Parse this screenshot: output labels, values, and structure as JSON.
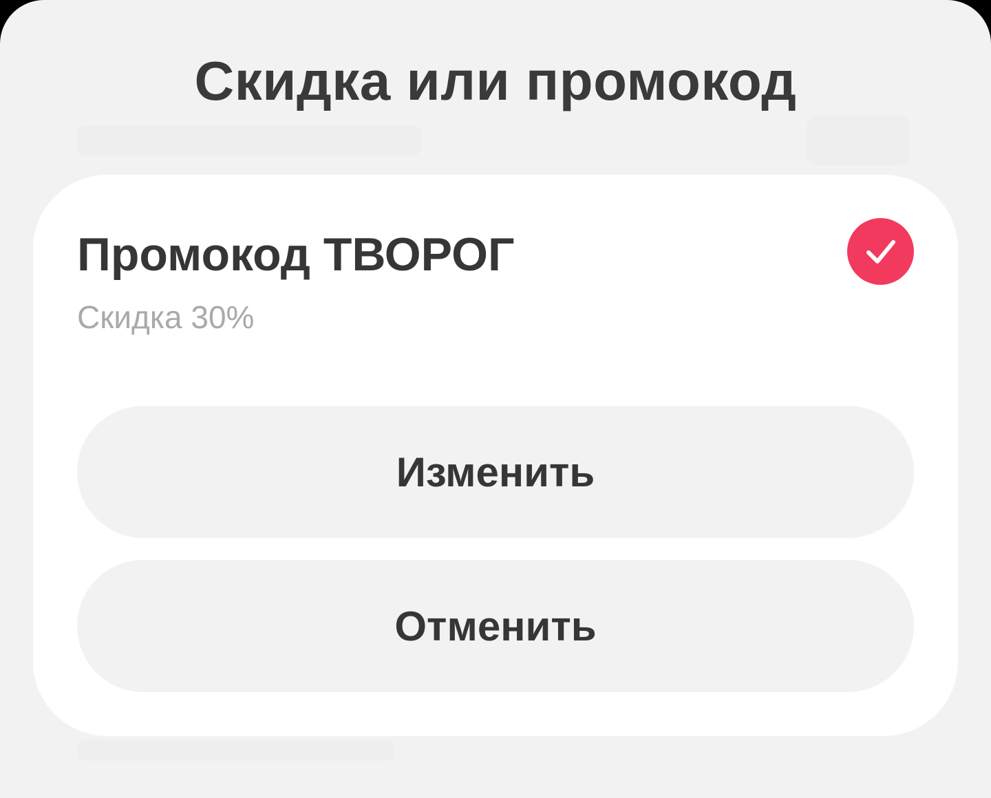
{
  "sheet": {
    "title": "Скидка или промокод"
  },
  "promo": {
    "title": "Промокод ТВОРОГ",
    "subtitle": "Скидка 30%",
    "selected": true,
    "accent_color": "#f23a5e",
    "check_icon": "checkmark-icon"
  },
  "actions": {
    "change_label": "Изменить",
    "cancel_label": "Отменить"
  }
}
